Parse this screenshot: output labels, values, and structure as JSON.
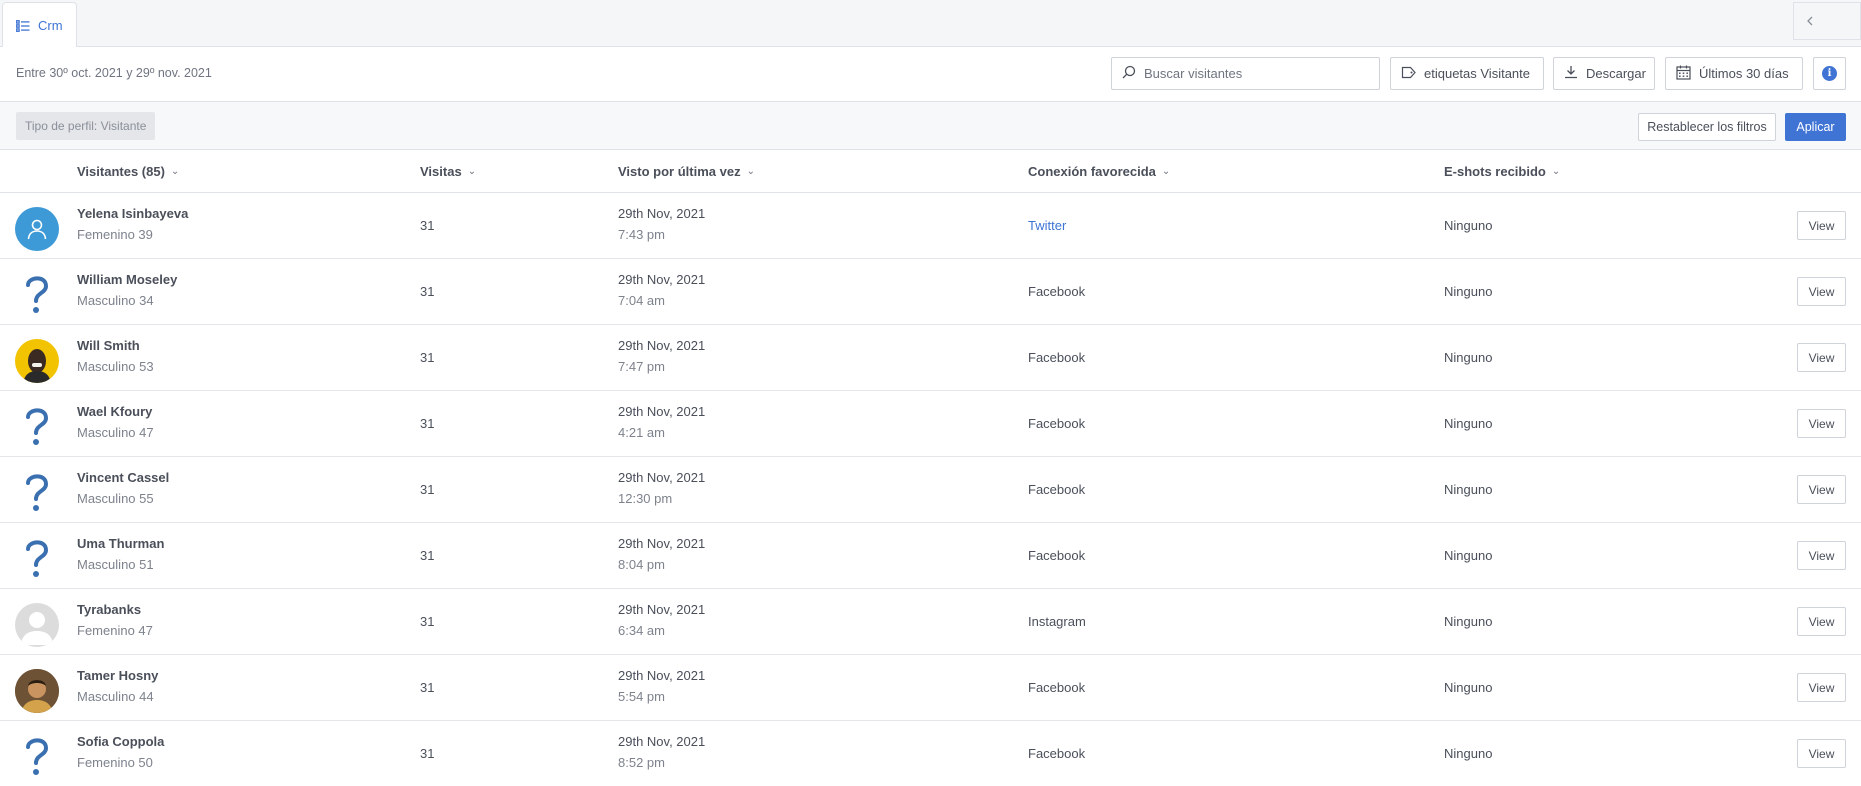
{
  "tab": {
    "label": "Crm",
    "icon": "list-icon"
  },
  "toolbar": {
    "date_range": "Entre 30º oct. 2021 y 29º nov. 2021",
    "search_placeholder": "Buscar visitantes",
    "tags_label": "etiquetas Visitante",
    "download_label": "Descargar",
    "range_label": "Últimos 30 días",
    "info_glyph": "i"
  },
  "filters": {
    "chip": "Tipo de perfil: Visitante",
    "reset_label": "Restablecer los filtros",
    "apply_label": "Aplicar"
  },
  "table": {
    "headers": {
      "visitors": "Visitantes (85)",
      "visits": "Visitas",
      "last_seen": "Visto por última vez",
      "connection": "Conexión favorecida",
      "eshots": "E-shots recibido"
    },
    "rows": [
      {
        "name": "Yelena Isinbayeva",
        "sub": "Femenino 39",
        "visits": "31",
        "date": "29th Nov, 2021",
        "time": "7:43 pm",
        "connection": "Twitter",
        "eshots": "Ninguno",
        "view": "View",
        "avatar": "user-icon"
      },
      {
        "name": "William Moseley",
        "sub": "Masculino 34",
        "visits": "31",
        "date": "29th Nov, 2021",
        "time": "7:04 am",
        "connection": "Facebook",
        "eshots": "Ninguno",
        "view": "View",
        "avatar": "question-icon"
      },
      {
        "name": "Will Smith",
        "sub": "Masculino 53",
        "visits": "31",
        "date": "29th Nov, 2021",
        "time": "7:47 pm",
        "connection": "Facebook",
        "eshots": "Ninguno",
        "view": "View",
        "avatar": "photo"
      },
      {
        "name": "Wael Kfoury",
        "sub": "Masculino 47",
        "visits": "31",
        "date": "29th Nov, 2021",
        "time": "4:21 am",
        "connection": "Facebook",
        "eshots": "Ninguno",
        "view": "View",
        "avatar": "question-icon"
      },
      {
        "name": "Vincent Cassel",
        "sub": "Masculino 55",
        "visits": "31",
        "date": "29th Nov, 2021",
        "time": "12:30 pm",
        "connection": "Facebook",
        "eshots": "Ninguno",
        "view": "View",
        "avatar": "question-icon"
      },
      {
        "name": "Uma Thurman",
        "sub": "Masculino 51",
        "visits": "31",
        "date": "29th Nov, 2021",
        "time": "8:04 pm",
        "connection": "Facebook",
        "eshots": "Ninguno",
        "view": "View",
        "avatar": "question-icon"
      },
      {
        "name": "Tyrabanks",
        "sub": "Femenino 47",
        "visits": "31",
        "date": "29th Nov, 2021",
        "time": "6:34 am",
        "connection": "Instagram",
        "eshots": "Ninguno",
        "view": "View",
        "avatar": "default-user-icon"
      },
      {
        "name": "Tamer Hosny",
        "sub": "Masculino 44",
        "visits": "31",
        "date": "29th Nov, 2021",
        "time": "5:54 pm",
        "connection": "Facebook",
        "eshots": "Ninguno",
        "view": "View",
        "avatar": "photo"
      },
      {
        "name": "Sofia Coppola",
        "sub": "Femenino 50",
        "visits": "31",
        "date": "29th Nov, 2021",
        "time": "8:52 pm",
        "connection": "Facebook",
        "eshots": "Ninguno",
        "view": "View",
        "avatar": "question-icon"
      }
    ]
  },
  "colors": {
    "accent": "#3f74d4",
    "avatar_blue": "#3d9ad6",
    "photo_yellow": "#f2c300"
  }
}
